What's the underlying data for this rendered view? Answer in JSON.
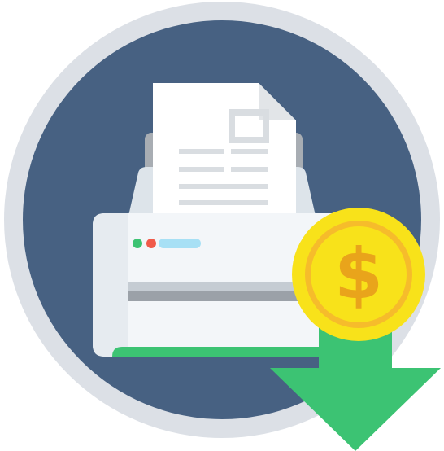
{
  "illustration": {
    "icon_name": "printer-cost-icon",
    "parts": {
      "background": "circle-badge",
      "printer": "printer-icon",
      "paper": "document-icon",
      "coin": "dollar-coin-icon",
      "arrow": "arrow-down-icon"
    },
    "coin_symbol": "$",
    "colors": {
      "ring": "#DCE0E6",
      "badge": "#476182",
      "printer_body": "#F3F6F9",
      "printer_side": "#DDE4EA",
      "printer_back": "#A8ADB3",
      "paper": "#FFFFFF",
      "paper_fold": "#E2E5E8",
      "paper_lines": "#D9DDE1",
      "led_green": "#3CC373",
      "led_red": "#F05A4A",
      "display": "#A7E0F5",
      "slot_light": "#C5CCD3",
      "slot_dark": "#9BA1A8",
      "tray": "#3CC373",
      "coin_outer": "#F8E21A",
      "coin_inner": "#F6BC2B",
      "coin_symbol_color": "#E9A41B",
      "arrow": "#3CC373"
    }
  }
}
